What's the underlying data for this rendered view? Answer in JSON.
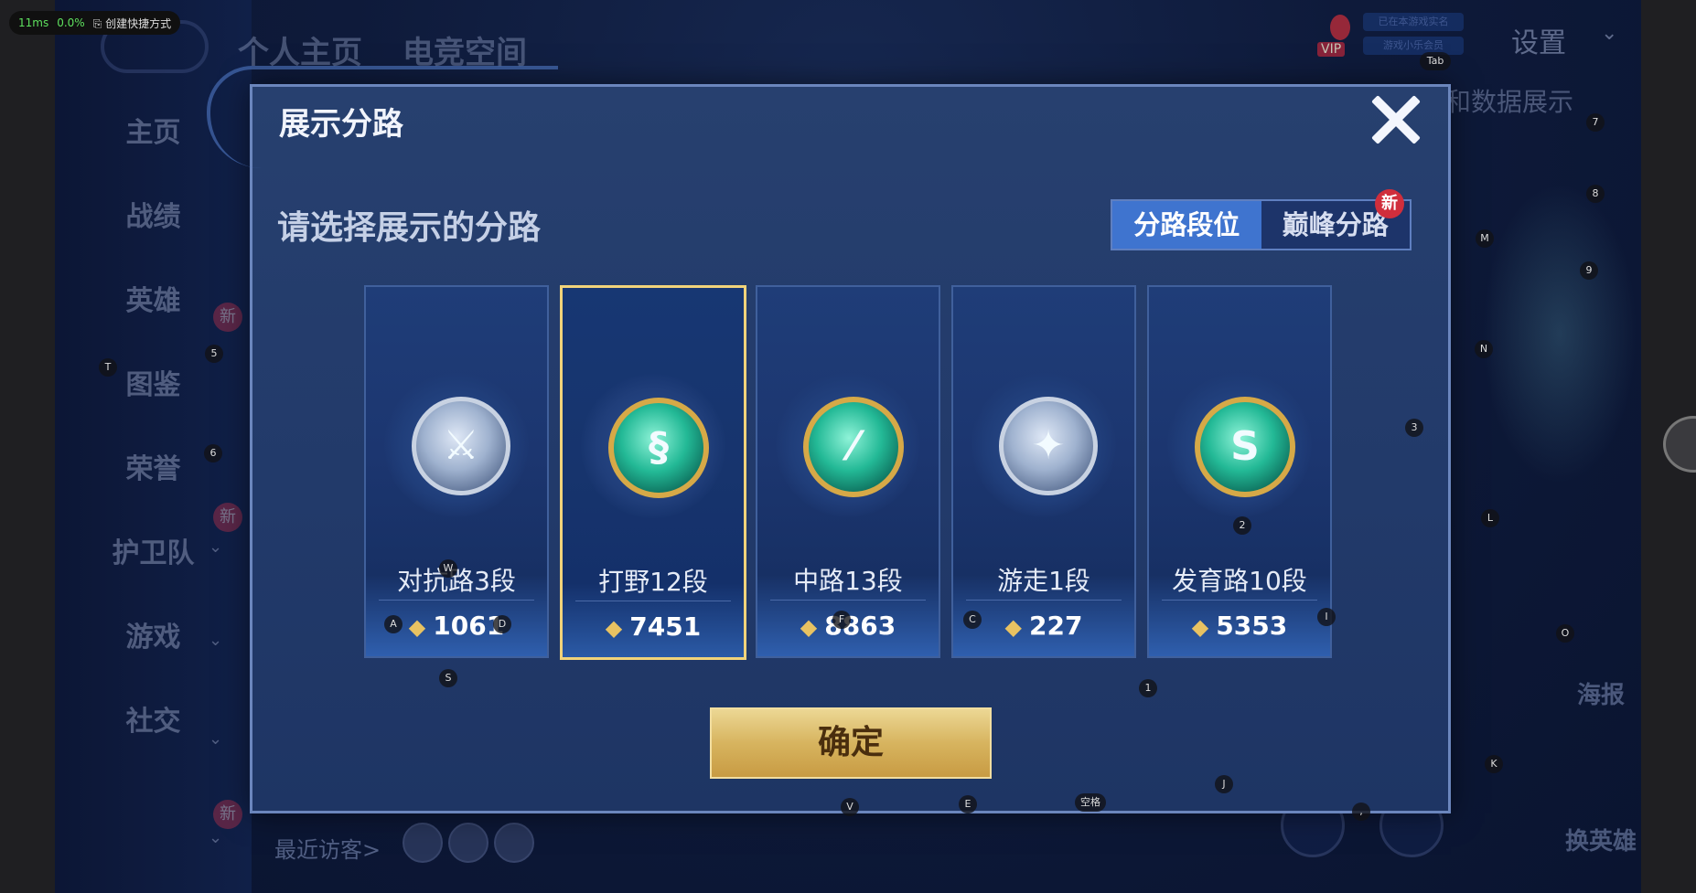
{
  "perf": {
    "ms": "11ms",
    "pct": "0.0%",
    "shortcut": "创建快捷方式"
  },
  "top_tabs": [
    "个人主页",
    "电竞空间"
  ],
  "sidebar": {
    "items": [
      {
        "label": "主页"
      },
      {
        "label": "战绩"
      },
      {
        "label": "英雄",
        "new": "新"
      },
      {
        "label": "图鉴"
      },
      {
        "label": "荣誉",
        "new": "新"
      },
      {
        "label": "护卫队"
      },
      {
        "label": "游戏"
      },
      {
        "label": "社交",
        "new": "新"
      }
    ]
  },
  "header": {
    "vip": "VIP",
    "settings": "设置",
    "pill1": "已在本游戏实名",
    "pill2": "游戏小乐会员",
    "bg_text": "和数据展示"
  },
  "footer": {
    "visitors": "最近访客>",
    "poster": "海报",
    "swap_hero": "换英雄"
  },
  "modal": {
    "title": "展示分路",
    "prompt": "请选择展示的分路",
    "tabs": [
      {
        "label": "分路段位",
        "active": true
      },
      {
        "label": "巅峰分路",
        "new": "新"
      }
    ],
    "cards": [
      {
        "name": "对抗路3段",
        "score": "1061",
        "badge": "silver",
        "glyph": "sword-icon"
      },
      {
        "name": "打野12段",
        "score": "7451",
        "badge": "gold",
        "glyph": "dragon-icon",
        "selected": true
      },
      {
        "name": "中路13段",
        "score": "8863",
        "badge": "gold",
        "glyph": "wand-icon"
      },
      {
        "name": "游走1段",
        "score": "227",
        "badge": "silver",
        "glyph": "wing-icon"
      },
      {
        "name": "发育路10段",
        "score": "5353",
        "badge": "gold",
        "glyph": "target-icon"
      }
    ],
    "confirm": "确定"
  },
  "key_hints": [
    "Tab",
    "7",
    "8",
    "M",
    "9",
    "N",
    "3",
    "L",
    "O",
    "K",
    "2",
    "I",
    "1",
    "J",
    "空格",
    "E",
    "V",
    "S",
    "A",
    "D",
    "W",
    "F",
    "C",
    "T",
    "5",
    "6",
    ","
  ]
}
